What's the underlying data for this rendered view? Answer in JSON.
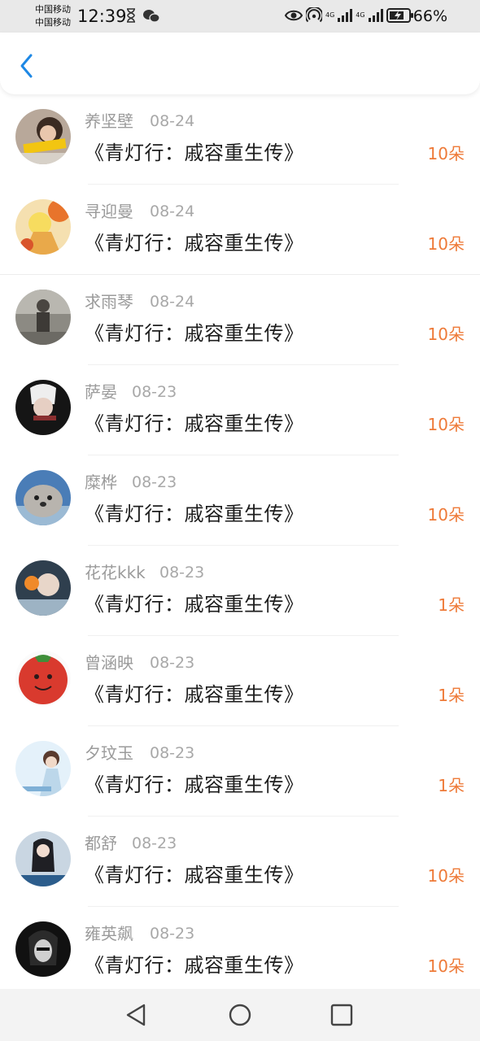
{
  "status_bar": {
    "carrier_1": "中国移动",
    "carrier_2": "中国移动",
    "time": "12:39",
    "battery": "66%",
    "net_1": "4G",
    "net_2": "4G"
  },
  "header": {
    "back_icon": "chevron-left-icon"
  },
  "gifts": [
    {
      "name": "养坚壁",
      "date": "08-24",
      "title": "《青灯行：戚容重生传》",
      "count": "10朵"
    },
    {
      "name": "寻迎曼",
      "date": "08-24",
      "title": "《青灯行：戚容重生传》",
      "count": "10朵"
    },
    {
      "name": "求雨琴",
      "date": "08-24",
      "title": "《青灯行：戚容重生传》",
      "count": "10朵"
    },
    {
      "name": "萨晏",
      "date": "08-23",
      "title": "《青灯行：戚容重生传》",
      "count": "10朵"
    },
    {
      "name": "糜桦",
      "date": "08-23",
      "title": "《青灯行：戚容重生传》",
      "count": "10朵"
    },
    {
      "name": "花花kkk",
      "date": "08-23",
      "title": "《青灯行：戚容重生传》",
      "count": "1朵"
    },
    {
      "name": "曾涵映",
      "date": "08-23",
      "title": "《青灯行：戚容重生传》",
      "count": "1朵"
    },
    {
      "name": "夕玟玉",
      "date": "08-23",
      "title": "《青灯行：戚容重生传》",
      "count": "1朵"
    },
    {
      "name": "都舒",
      "date": "08-23",
      "title": "《青灯行：戚容重生传》",
      "count": "10朵"
    },
    {
      "name": "雍英飙",
      "date": "08-23",
      "title": "《青灯行：戚容重生传》",
      "count": "10朵"
    }
  ],
  "colors": {
    "accent_blue": "#1e88e5",
    "count_orange": "#ee7a38",
    "meta_gray": "#9b9b9b"
  },
  "nav": {
    "back": "triangle-back-icon",
    "home": "circle-home-icon",
    "recents": "square-recents-icon"
  }
}
